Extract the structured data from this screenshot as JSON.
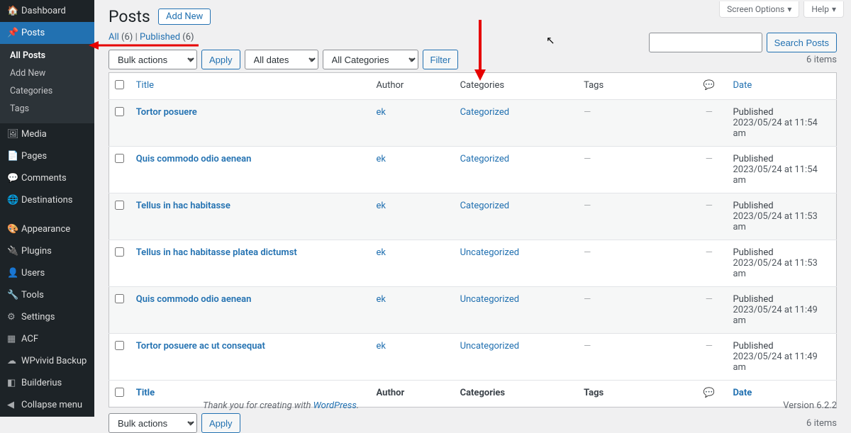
{
  "sidebar": {
    "top": [
      {
        "icon": "🏠",
        "label": "Dashboard"
      }
    ],
    "current": {
      "icon": "📌",
      "label": "Posts"
    },
    "submenu": [
      "All Posts",
      "Add New",
      "Categories",
      "Tags"
    ],
    "rest": [
      {
        "icon": "🖼",
        "label": "Media"
      },
      {
        "icon": "📄",
        "label": "Pages"
      },
      {
        "icon": "💬",
        "label": "Comments"
      },
      {
        "icon": "🌐",
        "label": "Destinations"
      },
      {
        "icon": "🎨",
        "label": "Appearance"
      },
      {
        "icon": "🔌",
        "label": "Plugins"
      },
      {
        "icon": "👤",
        "label": "Users"
      },
      {
        "icon": "🔧",
        "label": "Tools"
      },
      {
        "icon": "⚙",
        "label": "Settings"
      },
      {
        "icon": "▦",
        "label": "ACF"
      },
      {
        "icon": "☁",
        "label": "WPvivid Backup"
      },
      {
        "icon": "◧",
        "label": "Builderius"
      },
      {
        "icon": "◀",
        "label": "Collapse menu"
      }
    ]
  },
  "header": {
    "title": "Posts",
    "add_new": "Add New",
    "screen_options": "Screen Options",
    "help": "Help"
  },
  "subsubsub": {
    "all_label": "All",
    "all_count": "(6)",
    "sep": " | ",
    "pub_label": "Published",
    "pub_count": "(6)"
  },
  "filters": {
    "bulk": "Bulk actions",
    "apply": "Apply",
    "dates": "All dates",
    "cats": "All Categories",
    "filter": "Filter"
  },
  "search": {
    "placeholder": "",
    "button": "Search Posts"
  },
  "pagination": {
    "text": "6 items"
  },
  "columns": {
    "cb": "",
    "title": "Title",
    "author": "Author",
    "cats": "Categories",
    "tags": "Tags",
    "comments": "💬",
    "date": "Date"
  },
  "rows": [
    {
      "title": "Tortor posuere",
      "author": "ek",
      "cat": "Categorized",
      "tags": "—",
      "comments": "—",
      "status": "Published",
      "date": "2023/05/24 at 11:54 am"
    },
    {
      "title": "Quis commodo odio aenean",
      "author": "ek",
      "cat": "Categorized",
      "tags": "—",
      "comments": "—",
      "status": "Published",
      "date": "2023/05/24 at 11:54 am"
    },
    {
      "title": "Tellus in hac habitasse",
      "author": "ek",
      "cat": "Categorized",
      "tags": "—",
      "comments": "—",
      "status": "Published",
      "date": "2023/05/24 at 11:53 am"
    },
    {
      "title": "Tellus in hac habitasse platea dictumst",
      "author": "ek",
      "cat": "Uncategorized",
      "tags": "—",
      "comments": "—",
      "status": "Published",
      "date": "2023/05/24 at 11:53 am"
    },
    {
      "title": "Quis commodo odio aenean",
      "author": "ek",
      "cat": "Uncategorized",
      "tags": "—",
      "comments": "—",
      "status": "Published",
      "date": "2023/05/24 at 11:49 am"
    },
    {
      "title": "Tortor posuere ac ut consequat",
      "author": "ek",
      "cat": "Uncategorized",
      "tags": "—",
      "comments": "—",
      "status": "Published",
      "date": "2023/05/24 at 11:49 am"
    }
  ],
  "footer": {
    "thank_prefix": "Thank you for creating with ",
    "thank_link": "WordPress",
    "thank_suffix": ".",
    "version": "Version 6.2.2"
  }
}
